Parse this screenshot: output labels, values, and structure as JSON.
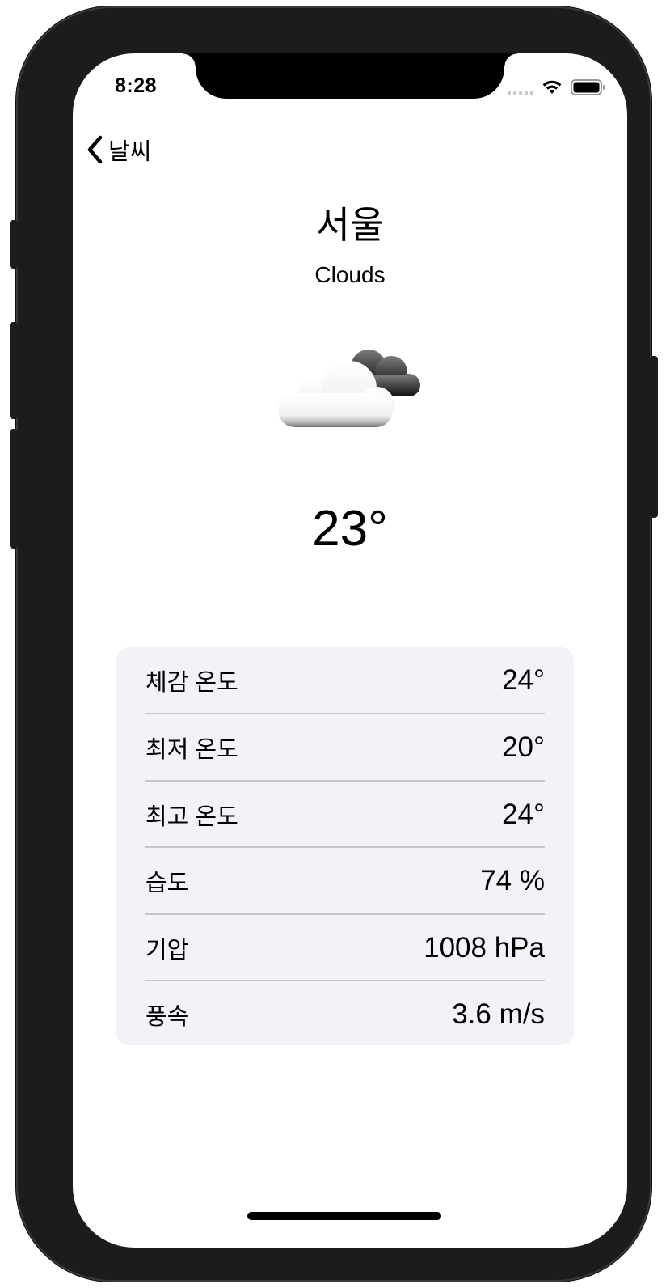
{
  "status_bar": {
    "time": "8:28"
  },
  "nav": {
    "back_label": "날씨"
  },
  "weather": {
    "city": "서울",
    "condition": "Clouds",
    "icon": "partly-cloudy-icon",
    "temperature": "23°"
  },
  "details": [
    {
      "label": "체감 온도",
      "value": "24°"
    },
    {
      "label": "최저 온도",
      "value": "20°"
    },
    {
      "label": "최고 온도",
      "value": "24°"
    },
    {
      "label": "습도",
      "value": "74 %"
    },
    {
      "label": "기압",
      "value": "1008 hPa"
    },
    {
      "label": "풍속",
      "value": "3.6 m/s"
    }
  ],
  "colors": {
    "card_background": "#f2f2f7",
    "divider": "#c6c6c8",
    "text": "#000000"
  }
}
